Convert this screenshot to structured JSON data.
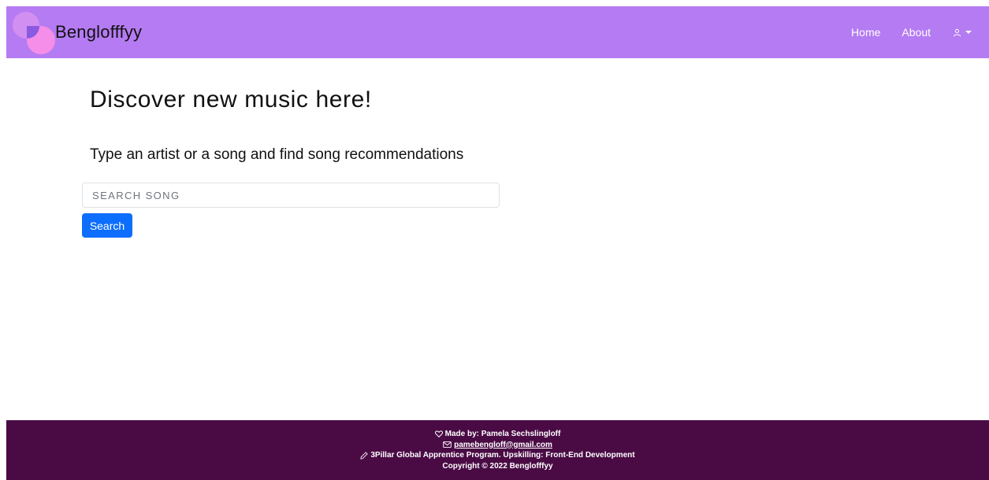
{
  "navbar": {
    "brand_name": "Benglofffyy",
    "links": [
      {
        "label": "Home"
      },
      {
        "label": "About"
      }
    ],
    "user_menu_icon": "person-icon",
    "user_menu_caret": "caret-down-icon"
  },
  "main": {
    "title": "Discover new music here!",
    "subtitle": "Type an artist or a song and find song recommendations",
    "search": {
      "placeholder": "Search song",
      "value": ""
    },
    "search_button_label": "Search"
  },
  "footer": {
    "made_by": "Made by: Pamela Sechslingloff",
    "email": "pamebengloff@gmail.com",
    "program": "3Pillar Global Apprentice Program. Upskilling: Front-End Development",
    "copyright": "Copyright © 2022 Benglofffyy"
  },
  "colors": {
    "navbar_bg": "#b57bf2",
    "footer_bg": "#4a0b45",
    "primary_button": "#0d6efd"
  }
}
